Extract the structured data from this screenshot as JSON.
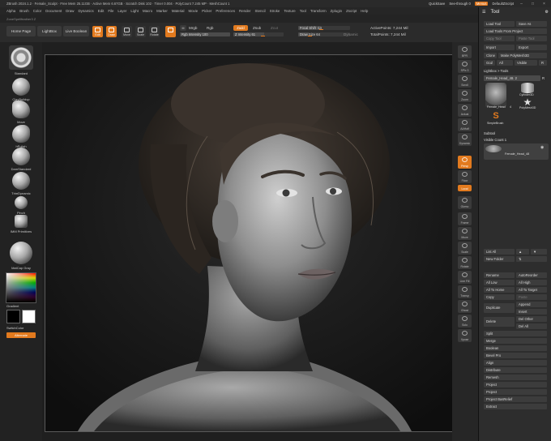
{
  "titlebar": {
    "text": "ZBrush 2024.1.2  ·  Female_Sculpt  ·  Free Mem 25.11GB  ·  Active Mem 6.67GB  ·  Scratch Disk 102  ·  Timer 0.004  ·  PolyCount 7.245 MP  ·  MeshCount 1",
    "quicksave": "QuickSave",
    "seethrough": "See-through 0",
    "menus_btn": "Menus",
    "script": "DefaultZScript"
  },
  "menubar": [
    "Alpha",
    "Brush",
    "Color",
    "Document",
    "Draw",
    "Dynamics",
    "Edit",
    "File",
    "Layer",
    "Light",
    "Macro",
    "Marker",
    "Material",
    "Movie",
    "Picker",
    "Preferences",
    "Render",
    "Stencil",
    "Stroke",
    "Texture",
    "Tool",
    "Transform",
    "Zplugin",
    "Zscript",
    "Help"
  ],
  "subbar": "ZoneSpellfeather3 Z",
  "toolbar": {
    "home": "Home Page",
    "lightbox": "LightBox",
    "livebool": "Live Boolean",
    "edit": "Edit",
    "draw": "Draw",
    "move": "Move",
    "scale": "Scale",
    "rotate": "Rotate",
    "mrgb": "Mrgb",
    "rgb": "Rgb",
    "m": "M",
    "rgb_intensity": "Rgb Intensity 100",
    "zadd": "Zadd",
    "zsub": "Zsub",
    "zcut": "Zcut",
    "z_intensity": "Z Intensity 61",
    "focal_shift": "Focal Shift -14",
    "draw_size": "Draw Size 64",
    "dynamic": "Dynamic",
    "active_points": "ActivePoints: 7,244 Mil",
    "total_points": "TotalPoints: 7,244 Mil"
  },
  "brushes": [
    "Standard",
    "ClayBuildup",
    "Move",
    "hPolish",
    "DamStandard",
    "TrimDynamic",
    "Pinch",
    "IMM Primitives",
    "MatCap Gray"
  ],
  "color": {
    "gradient": "Gradient",
    "switch": "SwitchColor",
    "alternate": "Alternate",
    "main": "#000000",
    "secondary": "#ffffff"
  },
  "rightshelf": [
    "BPR",
    "SPix 3",
    "Scroll",
    "Zoom",
    "Actual",
    "AAHalf",
    "Dynamic",
    "Persp",
    "Floor",
    "Local",
    "Gizmo",
    "Frame",
    "Move",
    "Scale",
    "Rotate",
    "Line Fill",
    "Transp",
    "Ghost",
    "Solo",
    "Xpose"
  ],
  "toolpanel": {
    "title": "Tool",
    "load_tool": "Load Tool",
    "save_as": "Save As",
    "load_from_project": "Load Tools From Project",
    "copy_tool": "Copy Tool",
    "paste_tool": "Paste Tool",
    "import": "Import",
    "export": "Export",
    "clone": "Clone",
    "make_polymesh": "Make PolyMesh3D",
    "goz": "GoZ",
    "all": "All",
    "visible": "Visible",
    "r": "R",
    "lightbox_tools": "Lightbox > Tools",
    "tool_name": "Female_Head_48. 2",
    "tool_count": "R",
    "thumb1": "Female_Head",
    "thumb2": "Cylinder3D",
    "thumb3": "PolyMesh3D",
    "thumb4": "SimpleBrush",
    "thumb_count": "4",
    "subtool": "Subtool",
    "visible_count": "Visible Count 1",
    "subtool_name": "Female_Head_48",
    "list_all": "List All",
    "new_folder": "New Folder",
    "rename": "Rename",
    "autoreorder": "AutoReorder",
    "all_low": "All Low",
    "all_high": "All High",
    "all_to_home": "All To Home",
    "all_to_target": "All To Target",
    "copy": "Copy",
    "paste": "Paste",
    "duplicate": "Duplicate",
    "append": "Append",
    "insert": "Insert",
    "delete": "Delete",
    "del_other": "Del Other",
    "del_all": "Del All",
    "split": "Split",
    "merge": "Merge",
    "boolean": "Boolean",
    "bevel_pro": "Bevel Pro",
    "align": "Align",
    "distribute": "Distribute",
    "remesh": "Remesh",
    "project": "Project",
    "project2": "Project",
    "project_bas": "Project BasRelief",
    "extract": "Extract"
  }
}
